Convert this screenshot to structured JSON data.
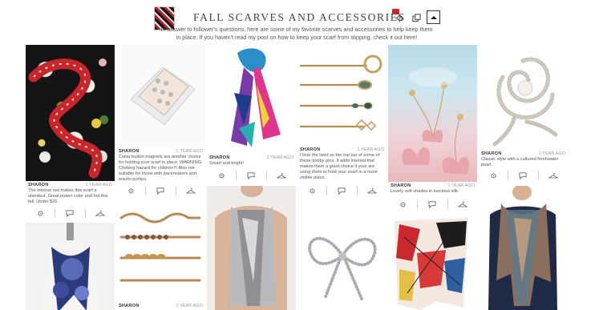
{
  "header": {
    "title": "FALL SCARVES AND ACCESSORIES",
    "description": "In answer to follower's questions, here are some of my favorite scarves and accessories to help keep them in place. If you haven't read my post on how to keep your scarf from slipping, check it out here!"
  },
  "colors": {
    "snake_red": "#c8262c",
    "badge_red": "#c62828",
    "divider": "#cfcfcf"
  },
  "cards": [
    {
      "author": "SHARON",
      "time": "1 YEAR AGO",
      "note": "The intense red makes this scarf a standout. Great power color and hot this fall. Under $20."
    },
    {
      "author": "SHARON",
      "time": "1 YEAR AGO",
      "note": "Collar button magnets are another choice for holding your scarf in place. WARNING: Choking hazard for children!!! Also not suitable for those with pacemakers and insulin pumps."
    },
    {
      "author": "SHARON",
      "time": "1 YEAR AGO",
      "note": "Smart and bright!"
    },
    {
      "author": "SHARON",
      "time": "1 YEAR AGO",
      "note": "I love the twist on the top bar of some of these bobby pins. It adds interest that makes them a good choice if your are using them to hold your scarf in a more visible place."
    },
    {
      "author": "SHARON",
      "time": "1 YEAR AGO",
      "note": "Lovely soft shades in luscious silk."
    },
    {
      "author": "SHARON",
      "time": "1 YEAR AGO",
      "note": "Classic style with a cultured freshwater pearl."
    },
    {
      "author": "SHARON",
      "time": "1 YEAR AGO",
      "note": ""
    }
  ]
}
